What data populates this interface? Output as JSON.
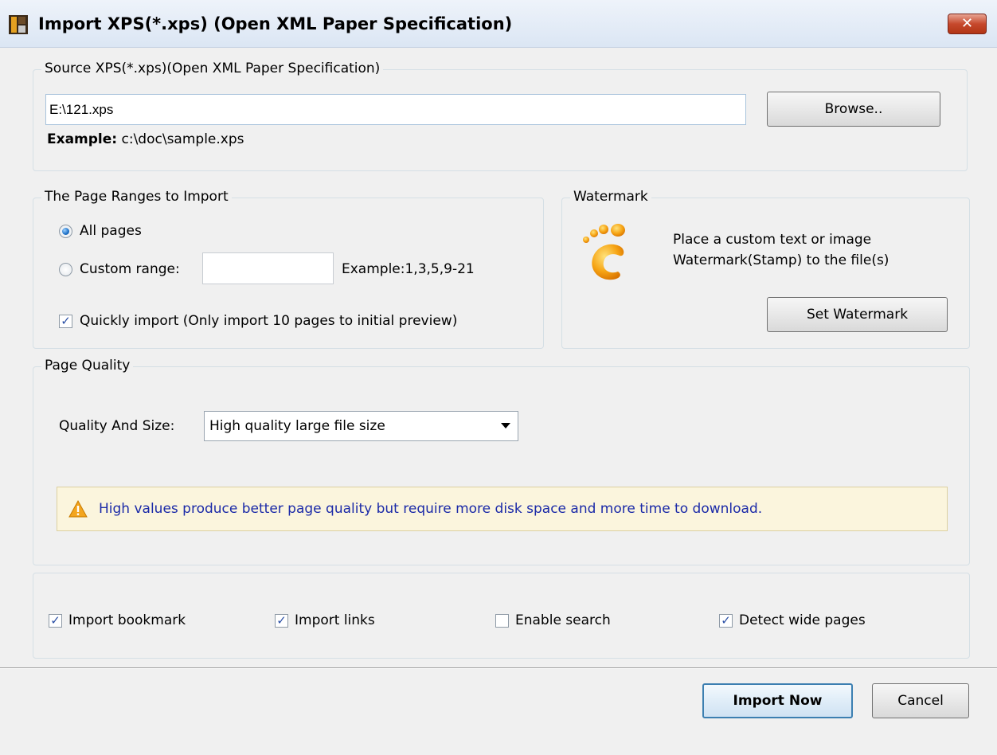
{
  "window": {
    "title": "Import XPS(*.xps) (Open XML Paper Specification)",
    "close_label": "✕"
  },
  "source": {
    "group_title": "Source XPS(*.xps)(Open XML Paper Specification)",
    "path_value": "E:\\121.xps",
    "browse_label": "Browse..",
    "example_label": "Example:",
    "example_value": "c:\\doc\\sample.xps"
  },
  "page_ranges": {
    "group_title": "The Page Ranges to Import",
    "all_pages_label": "All pages",
    "all_pages_checked": true,
    "custom_range_label": "Custom range:",
    "custom_range_value": "",
    "custom_example": "Example:1,3,5,9-21",
    "quick_import_label": "Quickly import (Only import 10 pages to  initial  preview)",
    "quick_import_checked": true
  },
  "watermark": {
    "group_title": "Watermark",
    "icon": "footprint-icon",
    "description_line1": "Place a custom text or image",
    "description_line2": "Watermark(Stamp) to the file(s)",
    "button_label": "Set Watermark"
  },
  "quality": {
    "group_title": "Page Quality",
    "label": "Quality And Size:",
    "selected": "High quality large file size",
    "warning": "High values produce better page quality but require more disk space and more time to download."
  },
  "options": {
    "import_bookmark": {
      "label": "Import bookmark",
      "checked": true
    },
    "import_links": {
      "label": "Import links",
      "checked": true
    },
    "enable_search": {
      "label": "Enable search",
      "checked": false
    },
    "detect_wide_pages": {
      "label": "Detect wide pages",
      "checked": true
    }
  },
  "footer": {
    "import_now_label": "Import Now",
    "cancel_label": "Cancel"
  },
  "colors": {
    "accent": "#3c7fb1",
    "warning_text": "#1b2aa8",
    "warning_bg": "#fbf5dd"
  }
}
